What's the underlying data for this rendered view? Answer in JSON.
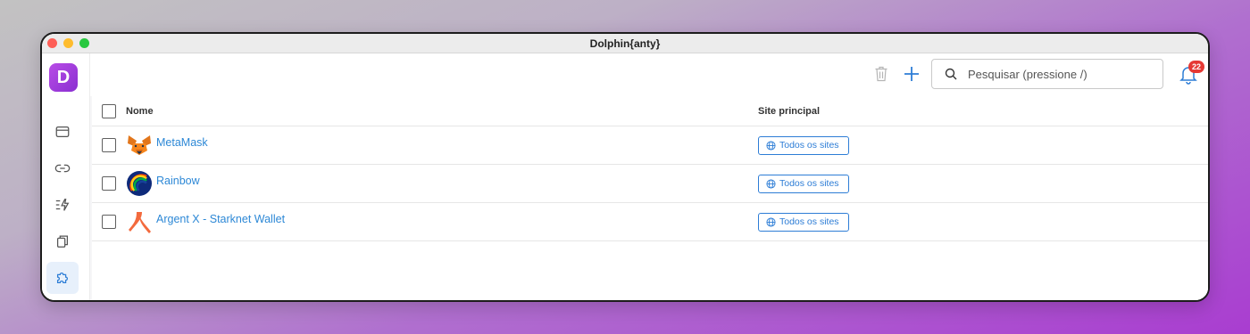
{
  "window": {
    "title": "Dolphin{anty}"
  },
  "sidebar": {
    "logo_letter": "D",
    "items": [
      {
        "icon": "browser-window-icon"
      },
      {
        "icon": "link-icon"
      },
      {
        "icon": "automation-icon"
      },
      {
        "icon": "copy-icon"
      },
      {
        "icon": "puzzle-extension-icon",
        "active": true
      }
    ]
  },
  "toolbar": {
    "search_placeholder": "Pesquisar (pressione /)",
    "notification_count": "22"
  },
  "table": {
    "headers": {
      "name": "Nome",
      "site": "Site principal"
    },
    "rows": [
      {
        "name": "MetaMask",
        "site": "Todos os sites",
        "icon": "metamask-fox-icon"
      },
      {
        "name": "Rainbow",
        "site": "Todos os sites",
        "icon": "rainbow-icon"
      },
      {
        "name": "Argent X - Starknet Wallet",
        "site": "Todos os sites",
        "icon": "argent-icon"
      }
    ]
  },
  "colors": {
    "accent": "#2d7dd6",
    "brand": "#9b3fdc",
    "badge": "#e53935"
  }
}
